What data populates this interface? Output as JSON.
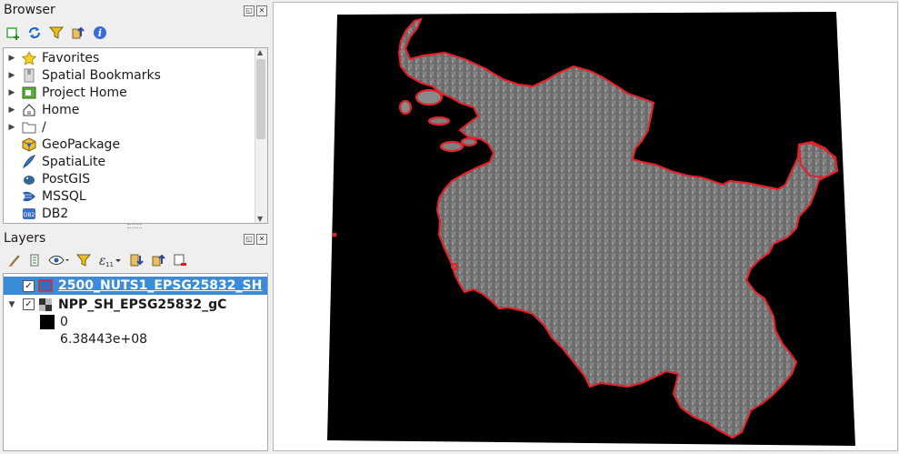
{
  "browser": {
    "title": "Browser",
    "items": [
      {
        "label": "Favorites",
        "icon": "star-icon",
        "expand": true
      },
      {
        "label": "Spatial Bookmarks",
        "icon": "bookmark-icon",
        "expand": true
      },
      {
        "label": "Project Home",
        "icon": "project-home-icon",
        "expand": true
      },
      {
        "label": "Home",
        "icon": "home-icon",
        "expand": true
      },
      {
        "label": "/",
        "icon": "folder-icon",
        "expand": true
      },
      {
        "label": "GeoPackage",
        "icon": "geopackage-icon",
        "expand": false
      },
      {
        "label": "SpatiaLite",
        "icon": "spatialite-icon",
        "expand": false
      },
      {
        "label": "PostGIS",
        "icon": "postgis-icon",
        "expand": false
      },
      {
        "label": "MSSQL",
        "icon": "mssql-icon",
        "expand": false
      },
      {
        "label": "DB2",
        "icon": "db2-icon",
        "expand": false
      }
    ]
  },
  "layers": {
    "title": "Layers",
    "vector_layer": "2500_NUTS1_EPSG25832_SH",
    "raster_layer": "NPP_SH_EPSG25832_gC",
    "legend_min": "0",
    "legend_max": "6.38443e+08"
  },
  "colors": {
    "selection": "#3a8bd8",
    "boundary": "#e0222a"
  }
}
